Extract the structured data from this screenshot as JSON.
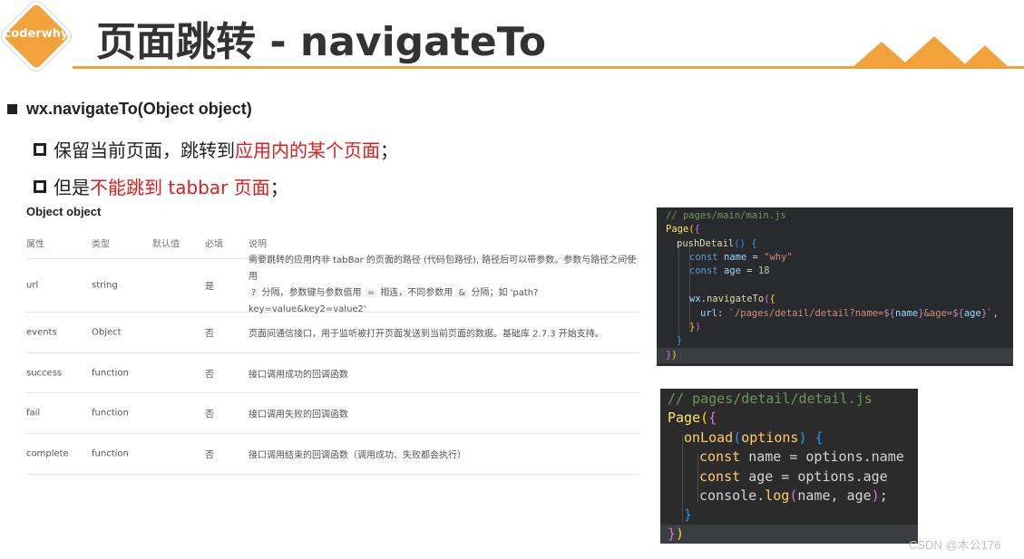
{
  "header": {
    "logo_text": "coderwhy",
    "title": "页面跳转 - navigateTo",
    "accent_color": "#f2a23a"
  },
  "bullets": {
    "main": "wx.navigateTo(Object object)",
    "items": [
      {
        "prefix": "保留当前页面，跳转到",
        "highlight": "应用内的某个页面",
        "suffix": "；"
      },
      {
        "prefix": "但是",
        "highlight": "不能跳到 tabbar 页面",
        "suffix": "；"
      }
    ]
  },
  "table": {
    "title": "Object object",
    "headers": [
      "属性",
      "类型",
      "默认值",
      "必填",
      "说明"
    ],
    "rows": [
      {
        "prop": "url",
        "type": "string",
        "default": "",
        "required": "是",
        "desc_line1": "需要跳转的应用内非 tabBar 的页面的路径 (代码包路径), 路径后可以带参数。参数与路径之间使用",
        "desc_q": "?",
        "desc_a": "分隔，参数键与参数值用",
        "desc_eq": "=",
        "desc_b": "相连，不同参数用",
        "desc_amp": "&",
        "desc_c": "分隔；如 'path?key=value&key2=value2'"
      },
      {
        "prop": "events",
        "type": "Object",
        "default": "",
        "required": "否",
        "desc": "页面间通信接口，用于监听被打开页面发送到当前页面的数据。基础库 2.7.3 开始支持。"
      },
      {
        "prop": "success",
        "type": "function",
        "default": "",
        "required": "否",
        "desc": "接口调用成功的回调函数"
      },
      {
        "prop": "fail",
        "type": "function",
        "default": "",
        "required": "否",
        "desc": "接口调用失败的回调函数"
      },
      {
        "prop": "complete",
        "type": "function",
        "default": "",
        "required": "否",
        "desc": "接口调用结束的回调函数（调用成功、失败都会执行）"
      }
    ]
  },
  "code_main": {
    "comment": "// pages/main/main.js",
    "page": "Page",
    "method": "pushDetail",
    "kw_const": "const",
    "var_name": "name",
    "str_why": "\"why\"",
    "var_age": "age",
    "num_18": "18",
    "wx": "wx",
    "navigate": "navigateTo",
    "url_key": "url",
    "tpl_a": "`/pages/detail/detail?name=",
    "tpl_b": "&age=",
    "tpl_end": "`",
    "tpl_name": "name",
    "tpl_age": "age"
  },
  "code_detail": {
    "comment": "// pages/detail/detail.js",
    "page": "Page",
    "method": "onLoad",
    "param": "options",
    "kw_const": "const",
    "var_name": "name",
    "var_age": "age",
    "rhs_name": "options.name",
    "rhs_age": "options.age",
    "console": "console",
    "log": "log",
    "log_args": "name, age"
  },
  "watermark": "CSDN @木公176"
}
